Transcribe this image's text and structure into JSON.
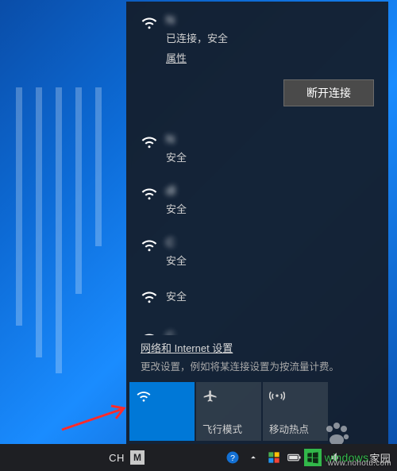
{
  "wallpaper": {
    "variant": "windows10-light-beams"
  },
  "flyout": {
    "connected": {
      "ssid": "N",
      "status": "已连接，安全",
      "properties_label": "属性",
      "disconnect_label": "断开连接"
    },
    "networks": [
      {
        "ssid": "N",
        "status": "安全"
      },
      {
        "ssid": "dl",
        "status": "安全"
      },
      {
        "ssid": "C",
        "status": "安全"
      },
      {
        "ssid": "",
        "status": "安全"
      },
      {
        "ssid": "C",
        "status": ""
      }
    ],
    "settings_link": "网络和 Internet 设置",
    "settings_desc": "更改设置，例如将某连接设置为按流量计费。",
    "tiles": {
      "wifi": {
        "label": "",
        "active": true
      },
      "airplane": {
        "label": "飞行模式",
        "active": false
      },
      "hotspot": {
        "label": "移动热点",
        "active": false
      }
    }
  },
  "taskbar": {
    "ime_lang": "CH",
    "ime_mode": "M"
  },
  "annotation": {
    "arrow_color": "#ff2b2b",
    "target": "wifi-tile"
  },
  "watermark": {
    "text": "windows",
    "site": "www.nohotu.com",
    "suffix": "家园"
  }
}
